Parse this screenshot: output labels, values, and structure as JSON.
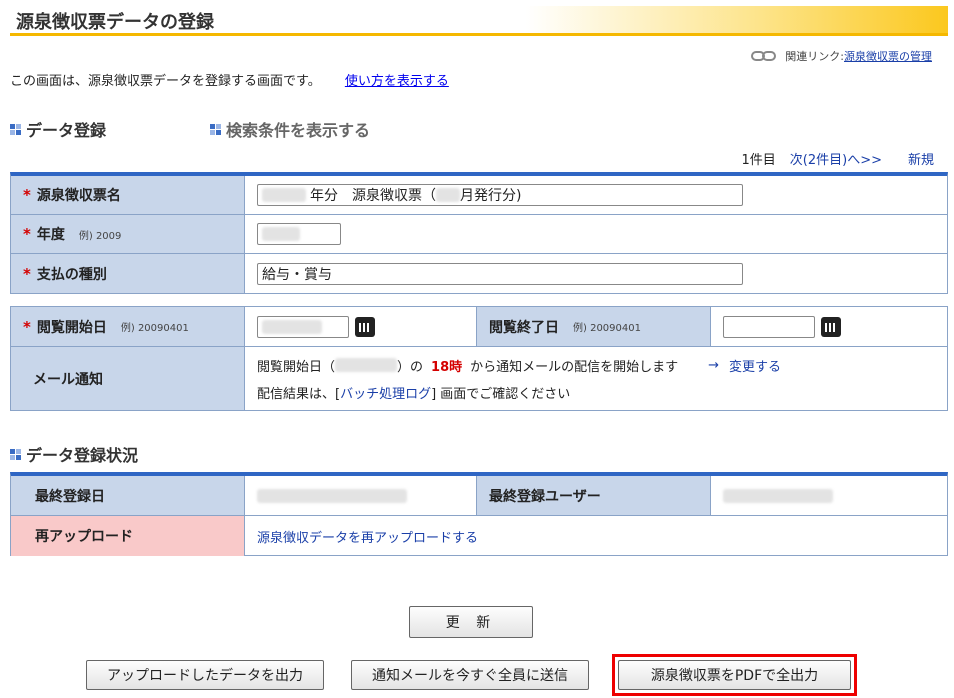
{
  "page": {
    "title": "源泉徴収票データの登録"
  },
  "related": {
    "label": "関連リンク:",
    "link": "源泉徴収票の管理",
    "icon": "chain-link-icon"
  },
  "intro": {
    "text": "この画面は、源泉徴収票データを登録する画面です。",
    "help_link": "使い方を表示する"
  },
  "sections": {
    "data_register": "データ登録",
    "show_search": "検索条件を表示する",
    "status": "データ登録状況"
  },
  "pager": {
    "current": "1件目",
    "next": "次(2件目)へ>>",
    "new": "新規"
  },
  "form": {
    "name_label": "源泉徴収票名",
    "name_part1": "年分　源泉徴収票（",
    "name_part2": "月発行分)",
    "year_label": "年度",
    "year_example": "例) 2009",
    "pay_label": "支払の種別",
    "pay_value": "給与・賞与",
    "start_label": "閲覧開始日",
    "start_example": "例) 20090401",
    "end_label": "閲覧終了日",
    "end_example": "例) 20090401",
    "mail_label": "メール通知",
    "mail_text1": "閲覧開始日（",
    "mail_text2": "）の",
    "mail_time": "18時",
    "mail_text3": "から通知メールの配信を開始します",
    "change_arrow": "→",
    "change_link": "変更する",
    "result_text1": "配信結果は、[",
    "result_link": "バッチ処理ログ",
    "result_text2": "] 画面でご確認ください"
  },
  "status": {
    "last_date_label": "最終登録日",
    "last_user_label": "最終登録ユーザー",
    "reupload_label": "再アップロード",
    "reupload_link": "源泉徴収データを再アップロードする"
  },
  "buttons": {
    "update": "更 新",
    "export_uploaded": "アップロードしたデータを出力",
    "send_mail": "通知メールを今すぐ全員に送信",
    "export_pdf": "源泉徴収票をPDFで全出力"
  },
  "colors": {
    "accent": "#2f66c4",
    "label_bg": "#c8d6ea",
    "highlight": "#e00000",
    "required": "#d40000"
  }
}
